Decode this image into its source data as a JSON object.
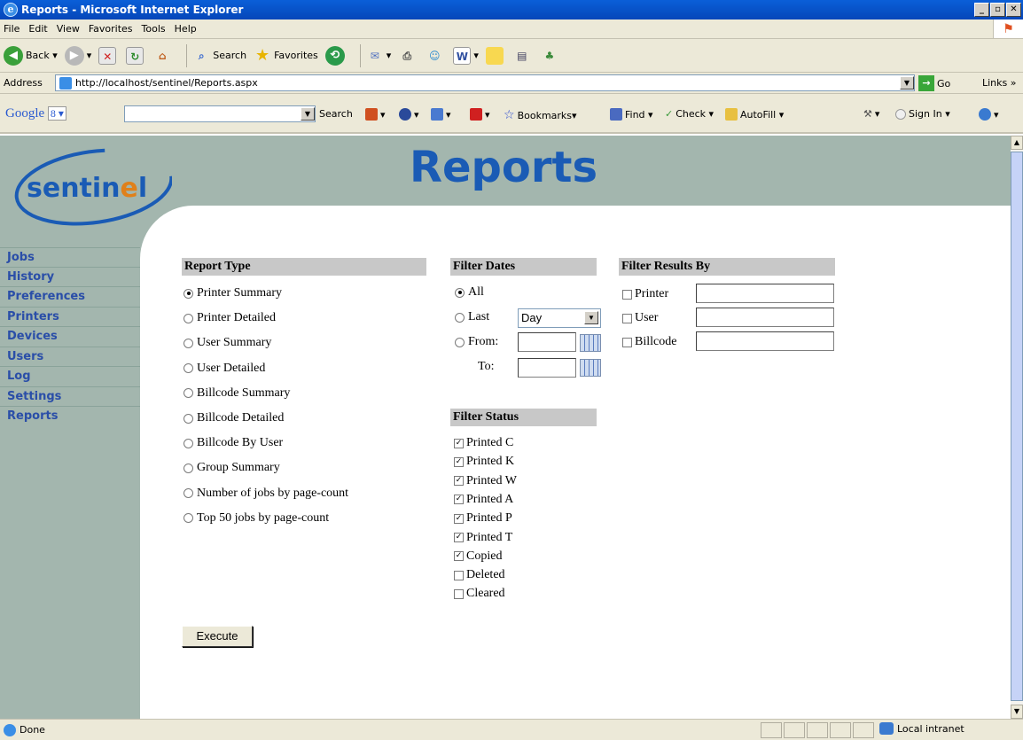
{
  "window": {
    "title": "Reports - Microsoft Internet Explorer"
  },
  "menu": [
    "File",
    "Edit",
    "View",
    "Favorites",
    "Tools",
    "Help"
  ],
  "toolbar": {
    "back": "Back",
    "search": "Search",
    "favorites": "Favorites"
  },
  "address": {
    "label": "Address",
    "url": "http://localhost/sentinel/Reports.aspx",
    "go": "Go",
    "links": "Links"
  },
  "googlebar": {
    "logo": "Google",
    "search": "Search",
    "bookmarks": "Bookmarks",
    "find": "Find",
    "check": "Check",
    "autofill": "AutoFill",
    "signin": "Sign In"
  },
  "page": {
    "logo": "sentinel",
    "heading": "Reports",
    "nav": [
      "Jobs",
      "History",
      "Preferences",
      "Printers",
      "Devices",
      "Users",
      "Log",
      "Settings",
      "Reports"
    ],
    "report_type": {
      "title": "Report Type",
      "options": [
        "Printer Summary",
        "Printer Detailed",
        "User Summary",
        "User Detailed",
        "Billcode Summary",
        "Billcode Detailed",
        "Billcode By User",
        "Group Summary",
        "Number of jobs by page-count",
        "Top 50 jobs by page-count"
      ],
      "selected": "Printer Summary"
    },
    "filter_dates": {
      "title": "Filter Dates",
      "all": "All",
      "last": "Last",
      "last_value": "Day",
      "from": "From:",
      "to": "To:"
    },
    "filter_status": {
      "title": "Filter Status",
      "items": [
        {
          "label": "Printed C",
          "checked": true
        },
        {
          "label": "Printed K",
          "checked": true
        },
        {
          "label": "Printed W",
          "checked": true
        },
        {
          "label": "Printed A",
          "checked": true
        },
        {
          "label": "Printed P",
          "checked": true
        },
        {
          "label": "Printed T",
          "checked": true
        },
        {
          "label": "Copied",
          "checked": true
        },
        {
          "label": "Deleted",
          "checked": false
        },
        {
          "label": "Cleared",
          "checked": false
        }
      ]
    },
    "filter_results": {
      "title": "Filter Results By",
      "items": [
        "Printer",
        "User",
        "Billcode"
      ]
    },
    "execute": "Execute"
  },
  "status": {
    "text": "Done",
    "zone": "Local intranet"
  }
}
